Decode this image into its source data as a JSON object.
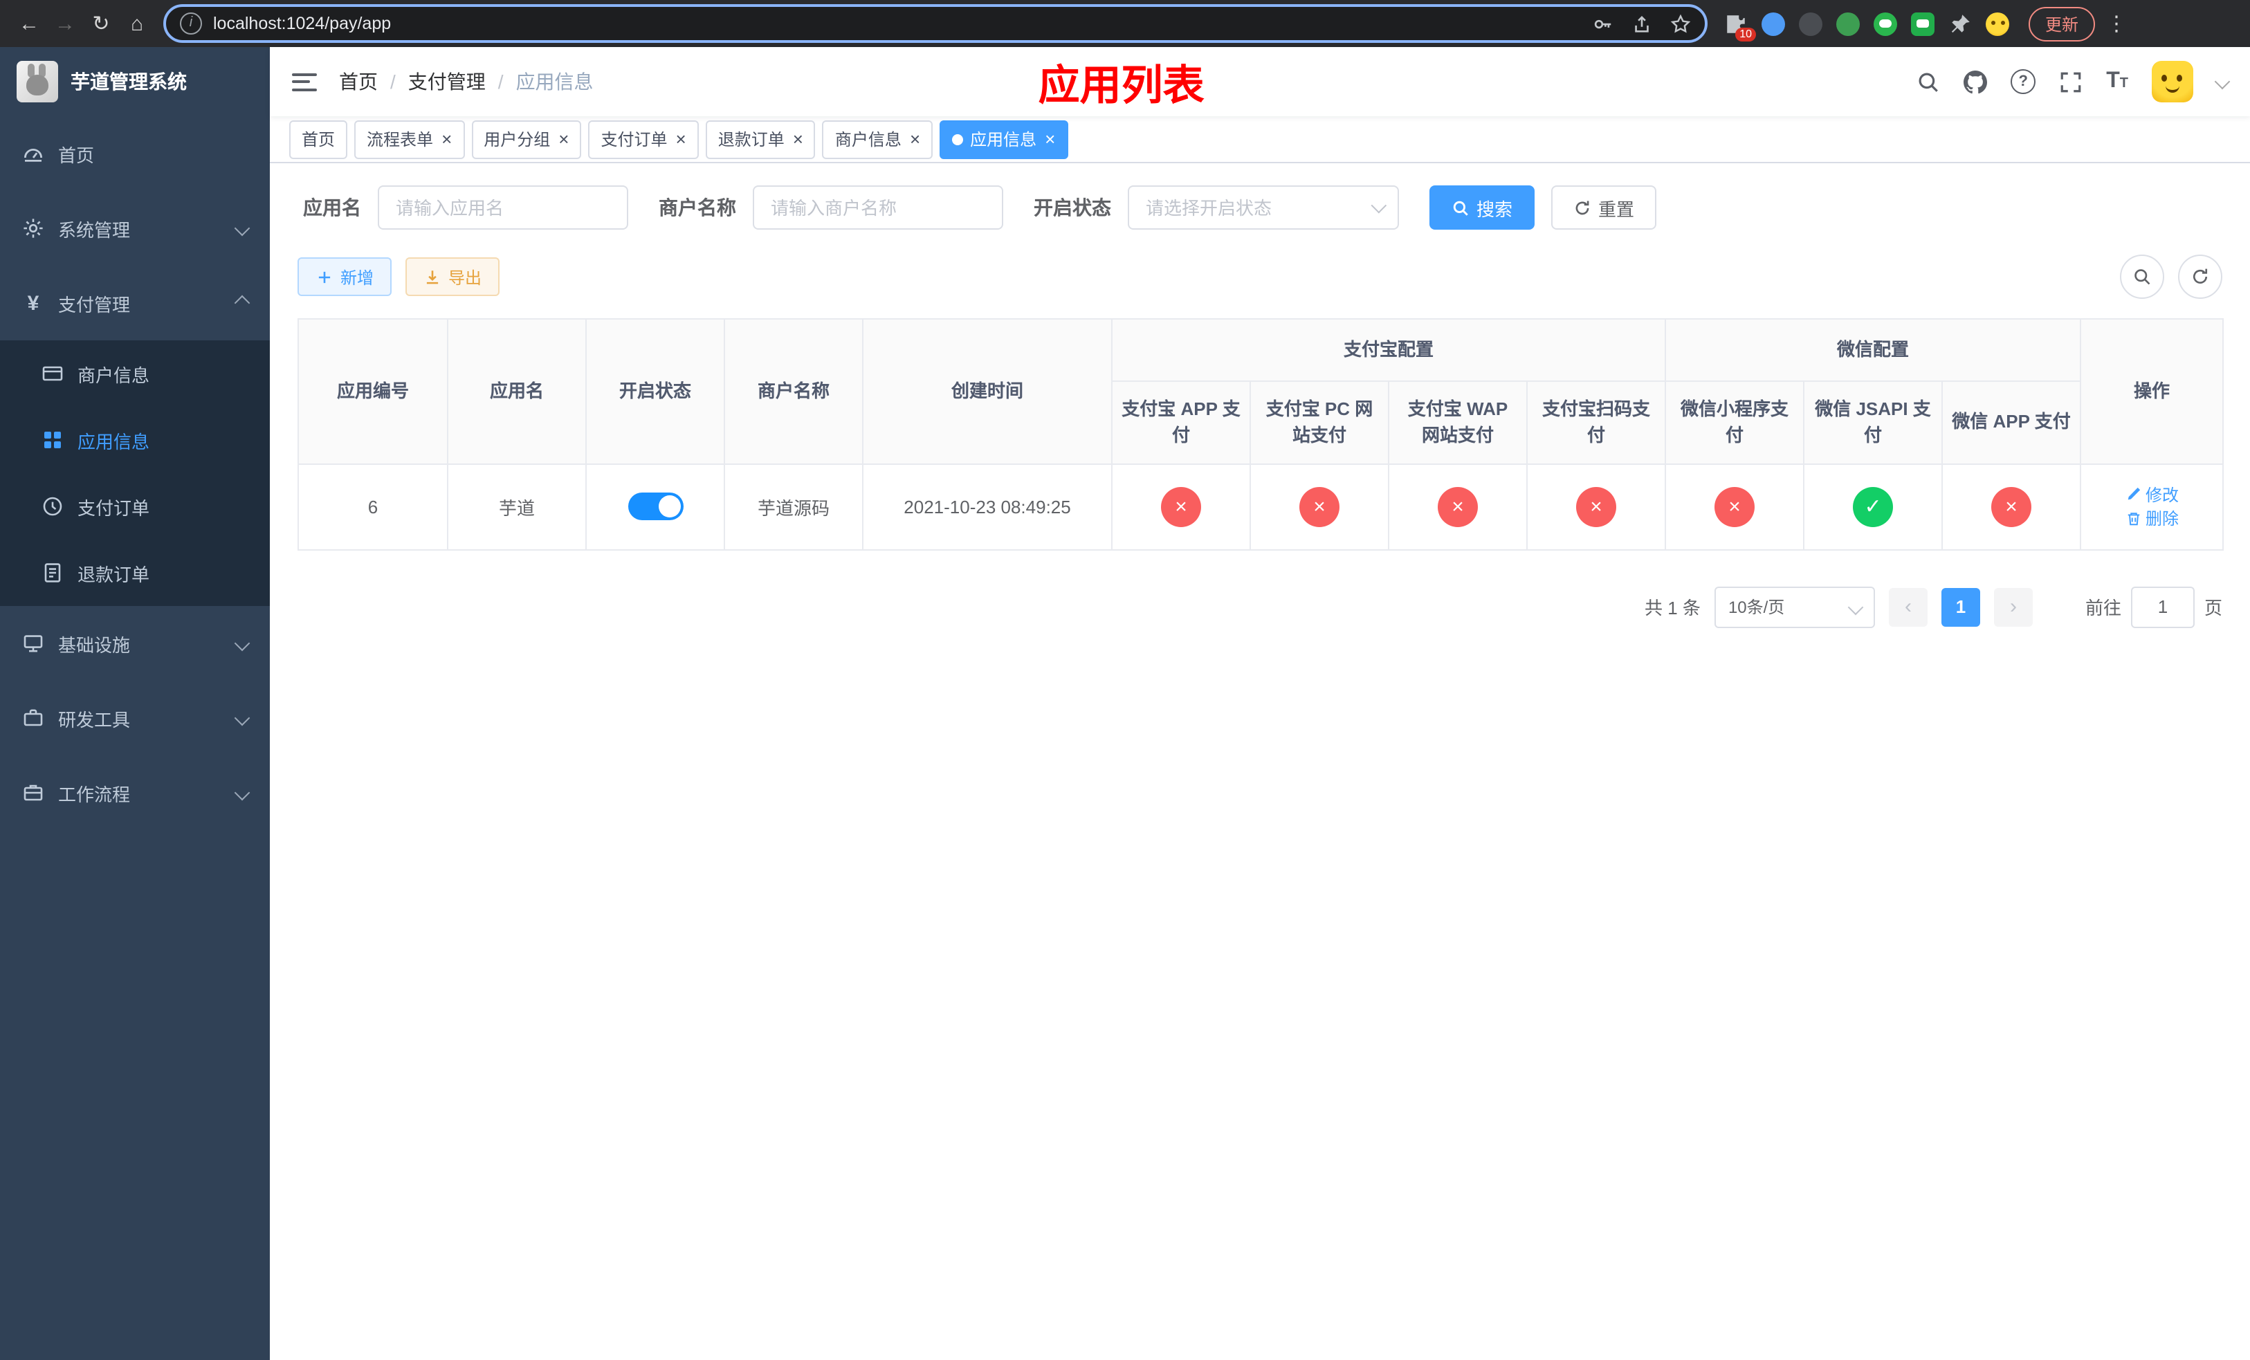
{
  "browser": {
    "url": "localhost:1024/pay/app",
    "update_label": "更新",
    "extensions_badge": "10"
  },
  "icons": {
    "back": "←",
    "forward": "→",
    "reload": "↻",
    "home": "⌂",
    "more": "⋮",
    "info": "i",
    "close": "×",
    "check": "✓",
    "cross": "×",
    "prev": "‹",
    "next": "›",
    "help": "?",
    "yen": "¥"
  },
  "sidebar": {
    "title": "芋道管理系统",
    "menu": [
      {
        "label": "首页"
      },
      {
        "label": "系统管理"
      },
      {
        "label": "支付管理"
      },
      {
        "label": "商户信息"
      },
      {
        "label": "应用信息"
      },
      {
        "label": "支付订单"
      },
      {
        "label": "退款订单"
      },
      {
        "label": "基础设施"
      },
      {
        "label": "研发工具"
      },
      {
        "label": "工作流程"
      }
    ]
  },
  "header": {
    "breadcrumb": [
      "首页",
      "支付管理",
      "应用信息"
    ],
    "separator": "/",
    "annotation": "应用列表"
  },
  "tabs": [
    {
      "label": "首页"
    },
    {
      "label": "流程表单"
    },
    {
      "label": "用户分组"
    },
    {
      "label": "支付订单"
    },
    {
      "label": "退款订单"
    },
    {
      "label": "商户信息"
    },
    {
      "label": "应用信息"
    }
  ],
  "filters": {
    "app_name_label": "应用名",
    "app_name_placeholder": "请输入应用名",
    "merchant_label": "商户名称",
    "merchant_placeholder": "请输入商户名称",
    "status_label": "开启状态",
    "status_placeholder": "请选择开启状态",
    "search_label": "搜索",
    "reset_label": "重置"
  },
  "toolbar": {
    "add_label": "新增",
    "export_label": "导出"
  },
  "table": {
    "header": {
      "app_id": "应用编号",
      "app_name": "应用名",
      "status": "开启状态",
      "merchant": "商户名称",
      "created": "创建时间",
      "alipay_group": "支付宝配置",
      "wechat_group": "微信配置",
      "alipay_app": "支付宝 APP 支付",
      "alipay_pc": "支付宝 PC 网站支付",
      "alipay_wap": "支付宝 WAP 网站支付",
      "alipay_scan": "支付宝扫码支付",
      "wx_mini": "微信小程序支付",
      "wx_jsapi": "微信 JSAPI 支付",
      "wx_app": "微信 APP 支付",
      "actions": "操作"
    },
    "rows": [
      {
        "app_id": "6",
        "app_name": "芋道",
        "status_on": true,
        "merchant": "芋道源码",
        "created": "2021-10-23 08:49:25",
        "alipay_app": false,
        "alipay_pc": false,
        "alipay_wap": false,
        "alipay_scan": false,
        "wx_mini": false,
        "wx_jsapi": true,
        "wx_app": false,
        "edit_label": "修改",
        "delete_label": "删除"
      }
    ]
  },
  "pagination": {
    "total": "共 1 条",
    "page_size": "10条/页",
    "page": "1",
    "goto_label": "前往",
    "goto_value": "1",
    "goto_suffix": "页"
  },
  "colors": {
    "primary": "#409eff",
    "danger": "#f95e5e",
    "success": "#13ce66",
    "warning": "#e6a23c",
    "annotation": "#ff0000",
    "sidebar_bg": "#304156",
    "submenu_bg": "#1f2d3d"
  }
}
